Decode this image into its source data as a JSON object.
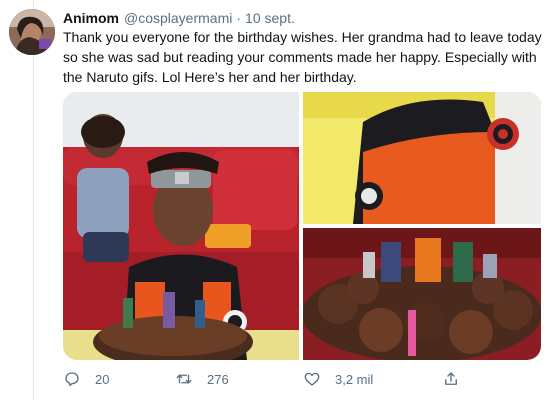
{
  "tweet": {
    "author_name": "Animom",
    "handle": "@cosplayermami",
    "separator": "·",
    "date": "10 sept.",
    "text": "Thank you everyone for the birthday wishes. Her grandma had to leave today so she was sad but reading your comments made her happy. Especially with the Naruto gifs. Lol Here’s her and her birthday."
  },
  "media": {
    "photos": [
      "kids-on-red-couch",
      "naruto-costume-closeup",
      "chocolate-cupcake-cake"
    ]
  },
  "actions": {
    "replies": "20",
    "retweets": "276",
    "likes": "3,2 mil",
    "icons": [
      "reply-icon",
      "retweet-icon",
      "like-icon",
      "share-icon"
    ]
  },
  "colors": {
    "text": "#0f1419",
    "muted": "#5b7083",
    "divider": "#e1e8ed"
  }
}
